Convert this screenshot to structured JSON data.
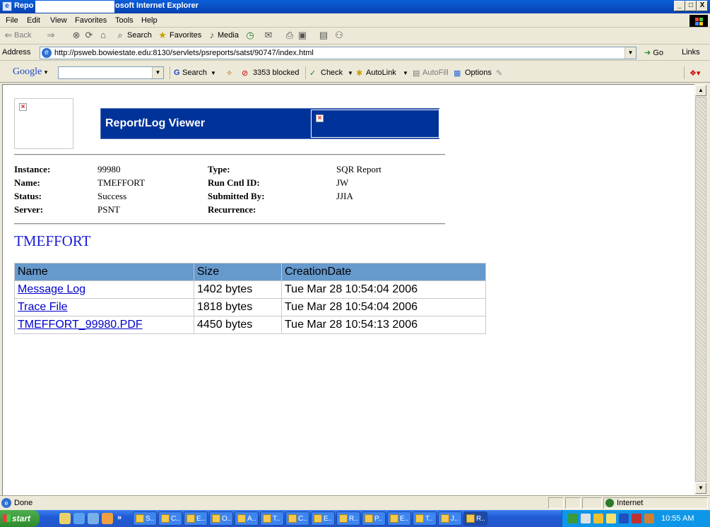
{
  "window": {
    "title_prefix": "Repo",
    "title_suffix": "osoft Internet Explorer",
    "buttons": [
      "_",
      "□",
      "X"
    ]
  },
  "menu": [
    "File",
    "Edit",
    "View",
    "Favorites",
    "Tools",
    "Help"
  ],
  "toolbar": {
    "back": "Back",
    "search": "Search",
    "favorites": "Favorites",
    "media": "Media"
  },
  "address": {
    "label": "Address",
    "url": "http://psweb.bowiestate.edu:8130/servlets/psreports/satst/90747/index.html",
    "go": "Go",
    "links": "Links"
  },
  "google_bar": {
    "logo": "Google",
    "search_value": "",
    "search_label": "Search",
    "blocked": "3353 blocked",
    "check": "Check",
    "autolink": "AutoLink",
    "autofill": "AutoFill",
    "options": "Options"
  },
  "page": {
    "banner_title": "Report/Log Viewer",
    "details": {
      "instance_label": "Instance:",
      "instance": "99980",
      "name_label": "Name:",
      "name": "TMEFFORT",
      "status_label": "Status:",
      "status": "Success",
      "server_label": "Server:",
      "server": "PSNT",
      "type_label": "Type:",
      "type": "SQR Report",
      "runcntl_label": "Run Cntl ID:",
      "runcntl": "JW",
      "submitted_label": "Submitted By:",
      "submitted": "JJIA",
      "recurrence_label": "Recurrence:",
      "recurrence": ""
    },
    "heading": "TMEFFORT",
    "table": {
      "columns": [
        "Name",
        "Size",
        "CreationDate"
      ],
      "rows": [
        {
          "name": "Message Log",
          "size": "1402 bytes",
          "date": "Tue Mar 28 10:54:04 2006"
        },
        {
          "name": "Trace File",
          "size": "1818 bytes",
          "date": "Tue Mar 28 10:54:04 2006"
        },
        {
          "name": "TMEFFORT_99980.PDF",
          "size": "4450 bytes",
          "date": "Tue Mar 28 10:54:13 2006"
        }
      ]
    }
  },
  "status": {
    "text": "Done",
    "zone": "Internet"
  },
  "taskbar": {
    "start": "start",
    "tasks": [
      "S..",
      "C..",
      "E..",
      "O..",
      "A..",
      "T..",
      "C..",
      "E..",
      "R..",
      "P..",
      "E..",
      "T..",
      "J..",
      "R.."
    ],
    "clock": "10:55 AM"
  }
}
